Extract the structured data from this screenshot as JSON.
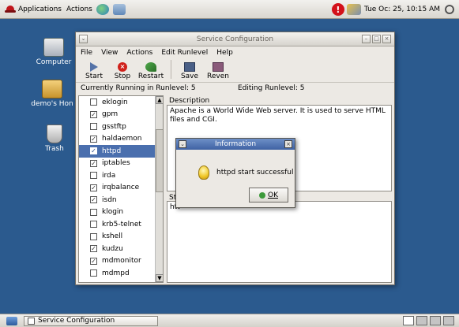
{
  "top_panel": {
    "applications": "Applications",
    "actions": "Actions",
    "clock": "Tue Oc: 25, 10:15 AM"
  },
  "desktop": {
    "icons": [
      {
        "label": "Computer",
        "icon": "computer-icon"
      },
      {
        "label": "demo's Hon",
        "icon": "home-folder-icon"
      },
      {
        "label": "Trash",
        "icon": "trash-icon"
      }
    ]
  },
  "window": {
    "title": "Service Configuration",
    "menu": [
      "File",
      "View",
      "Actions",
      "Edit Runlevel",
      "Help"
    ],
    "toolbar": {
      "start": "Start",
      "stop": "Stop",
      "restart": "Restart",
      "save": "Save",
      "revert": "Reven"
    },
    "status": {
      "running": "Currently Running in Runlevel: 5",
      "editing": "Editing Runlevel: 5"
    },
    "services": [
      {
        "name": "eklogin",
        "checked": false
      },
      {
        "name": "gpm",
        "checked": true
      },
      {
        "name": "gsstftp",
        "checked": false
      },
      {
        "name": "haldaemon",
        "checked": true
      },
      {
        "name": "httpd",
        "checked": true,
        "selected": true
      },
      {
        "name": "iptables",
        "checked": true
      },
      {
        "name": "irda",
        "checked": false
      },
      {
        "name": "irqbalance",
        "checked": true
      },
      {
        "name": "isdn",
        "checked": true
      },
      {
        "name": "klogin",
        "checked": false
      },
      {
        "name": "krb5-telnet",
        "checked": false
      },
      {
        "name": "kshell",
        "checked": false
      },
      {
        "name": "kudzu",
        "checked": true
      },
      {
        "name": "mdmonitor",
        "checked": true
      },
      {
        "name": "mdmpd",
        "checked": false
      }
    ],
    "description_label": "Description",
    "description_text": "Apache is a World Wide Web server.  It is used to serve HTML files and CGI.",
    "status_label": "St",
    "status_text": "htt"
  },
  "dialog": {
    "title": "Information",
    "message": "httpd start successful",
    "ok": "OK"
  },
  "bottom_panel": {
    "task": "Service Configuration"
  }
}
